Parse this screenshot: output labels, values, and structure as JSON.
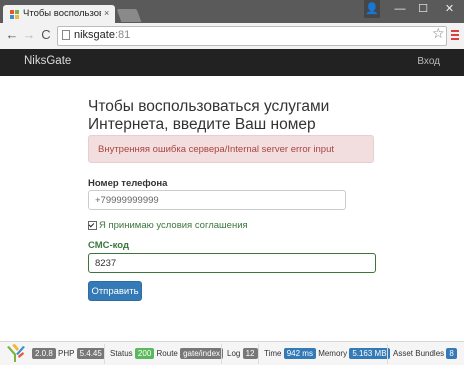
{
  "browser": {
    "tab_title": "Чтобы воспользоваться",
    "tab_close": "×",
    "url_host": "niksgate",
    "url_port": ":81",
    "window_controls": {
      "user": "👤",
      "minimize": "—",
      "maximize": "☐",
      "close": "✕"
    },
    "nav_icons": {
      "back": "←",
      "forward": "→",
      "reload": "C",
      "star": "☆"
    }
  },
  "navbar": {
    "brand": "NiksGate",
    "login": "Вход"
  },
  "main": {
    "heading": "Чтобы воспользоваться услугами Интернета, введите Ваш номер телефона",
    "alert": "Внутренняя ошибка сервера/Internal server error input",
    "phone_label": "Номер телефона",
    "phone_placeholder": "+79999999999",
    "agree_label": "Я принимаю условия соглашения",
    "sms_label": "СМС-код",
    "sms_value": "8237",
    "submit_label": "Отправить"
  },
  "debug_toolbar": {
    "yii_version": "2.0.8",
    "php_label": "PHP",
    "php_version": "5.4.45",
    "status_label": "Status",
    "status_code": "200",
    "route_label": "Route",
    "route_value": "gate/index",
    "log_label": "Log",
    "log_count": "12",
    "time_label": "Time",
    "time_value": "942 ms",
    "memory_label": "Memory",
    "memory_value": "5.163 MB",
    "bundles_label": "Asset Bundles",
    "bundles_count": "8"
  },
  "colors": {
    "navbar_bg": "#222222",
    "alert_bg": "#f2dede",
    "alert_text": "#a94442",
    "success": "#3c763d",
    "primary": "#337ab7",
    "badge_gray": "#777777",
    "badge_green": "#5cb85c",
    "badge_blue": "#337ab7"
  }
}
